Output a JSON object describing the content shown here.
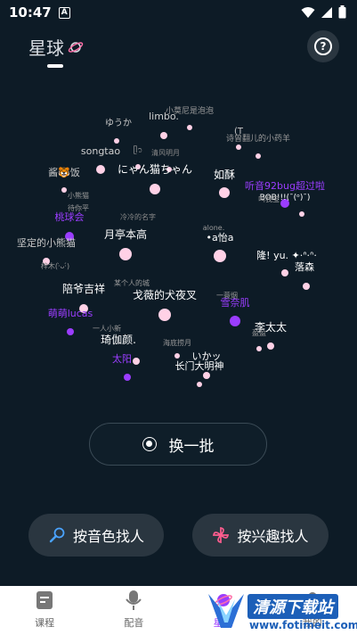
{
  "status_bar": {
    "time": "10:47",
    "a_badge": "A"
  },
  "header": {
    "title": "星球"
  },
  "stars": [
    {
      "label": "ゆうか",
      "color": "#c8c8c8",
      "size": 10
    },
    {
      "label": "limbo.",
      "color": "#d0d0d0",
      "size": 11
    },
    {
      "label": "小莫尼是泡泡",
      "color": "#9a9a9a",
      "size": 9
    },
    {
      "label": "(T",
      "color": "#c8c8c8",
      "size": 10
    },
    {
      "label": "诗曾翻儿的小药羊",
      "color": "#9a9a9a",
      "size": 9
    },
    {
      "label": "songtao",
      "color": "#d0d0d0",
      "size": 11
    },
    {
      "label": "ᥫ᭡",
      "color": "#9a9a9a",
      "size": 9
    },
    {
      "label": "清风明月",
      "color": "#8a8a8a",
      "size": 8
    },
    {
      "label": "酱🐯饭",
      "color": "#c8c8c8",
      "size": 11
    },
    {
      "label": "にゃん猫ちゃん",
      "color": "#ffffff",
      "size": 12
    },
    {
      "label": "如酥",
      "color": "#ffffff",
      "size": 12
    },
    {
      "label": "听音92bug超过啦",
      "color": "#9b3dff",
      "size": 11
    },
    {
      "label": "BOB!!!(ˉ(ᵒ)ˉ)",
      "color": "#ffffff",
      "size": 9
    },
    {
      "label": "叫我宝",
      "color": "#9a9a9a",
      "size": 8
    },
    {
      "label": "小熊猫",
      "color": "#9a9a9a",
      "size": 8
    },
    {
      "label": "待你平",
      "color": "#9a9a9a",
      "size": 8
    },
    {
      "label": "桃球会",
      "color": "#9b3dff",
      "size": 11
    },
    {
      "label": "冷冷的名字",
      "color": "#8a8a8a",
      "size": 8
    },
    {
      "label": "坚定的小熊猫",
      "color": "#c8c8c8",
      "size": 11
    },
    {
      "label": "月亭本高",
      "color": "#ffffff",
      "size": 12
    },
    {
      "label": "alone.",
      "color": "#9a9a9a",
      "size": 8
    },
    {
      "label": "•a怡a",
      "color": "#ffffff",
      "size": 11
    },
    {
      "label": "隆! yu. ✦·ᐢ·ᐢ·",
      "color": "#ffffff",
      "size": 11
    },
    {
      "label": "梓木(·̀ᴗ·́)",
      "color": "#9a9a9a",
      "size": 8
    },
    {
      "label": "落森",
      "color": "#ffffff",
      "size": 11
    },
    {
      "label": "陪爷吉祥",
      "color": "#ffffff",
      "size": 12
    },
    {
      "label": "某个人的城",
      "color": "#9a9a9a",
      "size": 8
    },
    {
      "label": "戈薇的犬夜叉",
      "color": "#ffffff",
      "size": 12
    },
    {
      "label": "一蓑烟",
      "color": "#9a9a9a",
      "size": 8
    },
    {
      "label": "雪奈肌",
      "color": "#9b3dff",
      "size": 11
    },
    {
      "label": "萌萌lucas",
      "color": "#9b3dff",
      "size": 11
    },
    {
      "label": "李太太",
      "color": "#ffffff",
      "size": 12
    },
    {
      "label": "一人小新",
      "color": "#9a9a9a",
      "size": 8
    },
    {
      "label": "盈盈",
      "color": "#9a9a9a",
      "size": 8
    },
    {
      "label": "琦伽颜.",
      "color": "#ffffff",
      "size": 12
    },
    {
      "label": "海底捞月",
      "color": "#9a9a9a",
      "size": 8
    },
    {
      "label": "太阳",
      "color": "#9b3dff",
      "size": 11
    },
    {
      "label": "いかッ",
      "color": "#ffffff",
      "size": 11
    },
    {
      "label": "长门大明神",
      "color": "#ffffff",
      "size": 11
    }
  ],
  "refresh_button": {
    "label": "换一批"
  },
  "find_by_voice": {
    "label": "按音色找人"
  },
  "find_by_interest": {
    "label": "按兴趣找人"
  },
  "tabbar": {
    "tabs": [
      {
        "label": "课程",
        "icon": "book-icon"
      },
      {
        "label": "配音",
        "icon": "microphone-icon"
      },
      {
        "label": "星球",
        "icon": "planet-icon"
      },
      {
        "label": "我的",
        "icon": "person-icon"
      }
    ],
    "active": 2
  },
  "watermark": {
    "title": "清源下载站",
    "url": "www.fotimeit.com"
  },
  "colors": {
    "background": "#0d1b26",
    "accent": "#9b3dff",
    "star_pink": "#ffd1e6"
  }
}
